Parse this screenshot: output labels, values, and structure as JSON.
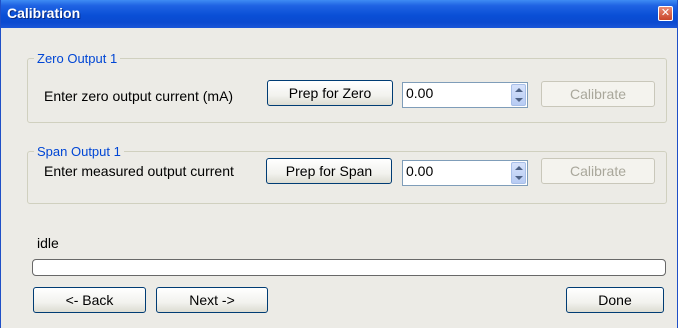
{
  "window": {
    "title": "Calibration",
    "close_glyph": "✕"
  },
  "zero_group": {
    "legend": "Zero Output 1",
    "label": "Enter zero output current (mA)",
    "prep_button": "Prep for Zero",
    "value": "0.00",
    "calibrate_button": "Calibrate"
  },
  "span_group": {
    "legend": "Span Output 1",
    "label": "Enter measured output current",
    "prep_button": "Prep for Span",
    "value": "0.00",
    "calibrate_button": "Calibrate"
  },
  "status": {
    "text": "idle",
    "progress": 0
  },
  "footer": {
    "back_button": "<- Back",
    "next_button": "Next ->",
    "done_button": "Done"
  },
  "icons": {
    "close": "close-icon",
    "spin_up": "chevron-up-icon",
    "spin_down": "chevron-down-icon"
  }
}
